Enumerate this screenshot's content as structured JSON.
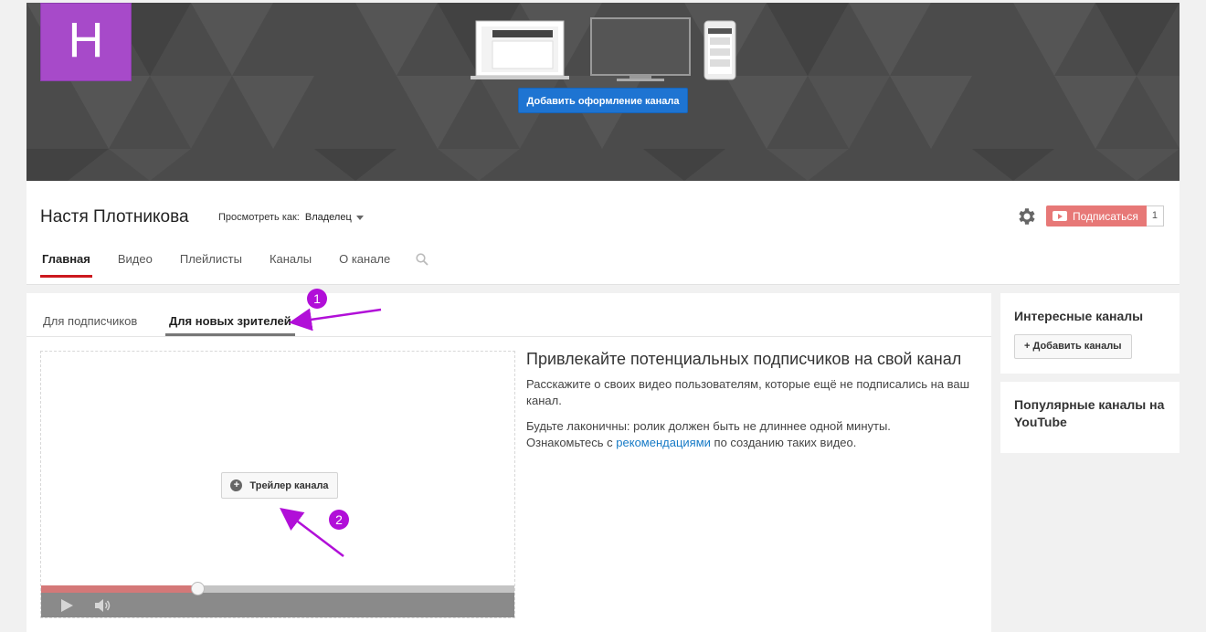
{
  "banner": {
    "avatar_letter": "H",
    "add_art_label": "Добавить оформление канала"
  },
  "channel": {
    "name": "Настя Плотникова",
    "view_as_label": "Просмотреть как:",
    "view_as_value": "Владелец",
    "subscribe_label": "Подписаться",
    "subscriber_count": "1"
  },
  "tabs": [
    {
      "label": "Главная",
      "active": true
    },
    {
      "label": "Видео"
    },
    {
      "label": "Плейлисты"
    },
    {
      "label": "Каналы"
    },
    {
      "label": "О канале"
    }
  ],
  "subtabs": {
    "subscribers": "Для подписчиков",
    "new_viewers": "Для новых зрителей"
  },
  "player": {
    "trailer_label": "Трейлер канала",
    "progress_fraction": 0.33
  },
  "promo": {
    "title": "Привлекайте потенциальных подписчиков на свой канал",
    "p1": "Расскажите о своих видео пользователям, которые ещё не подписались на ваш канал.",
    "p2_line1": "Будьте лаконичны: ролик должен быть не длиннее одной минуты.",
    "p2_pre": "Ознакомьтесь с ",
    "p2_link": "рекомендациями",
    "p2_post": " по созданию таких видео."
  },
  "sidebar": {
    "interesting_title": "Интересные каналы",
    "add_channels_label": "+ Добавить каналы",
    "popular_title": "Популярные каналы на YouTube"
  },
  "annotations": {
    "badge1": "1",
    "badge2": "2"
  },
  "colors": {
    "accent_red": "#cc181e",
    "subscribe": "#e77877",
    "button_blue": "#1e74d2",
    "avatar": "#a74ac9",
    "annotation": "#b10fd8",
    "link": "#167ac6"
  }
}
